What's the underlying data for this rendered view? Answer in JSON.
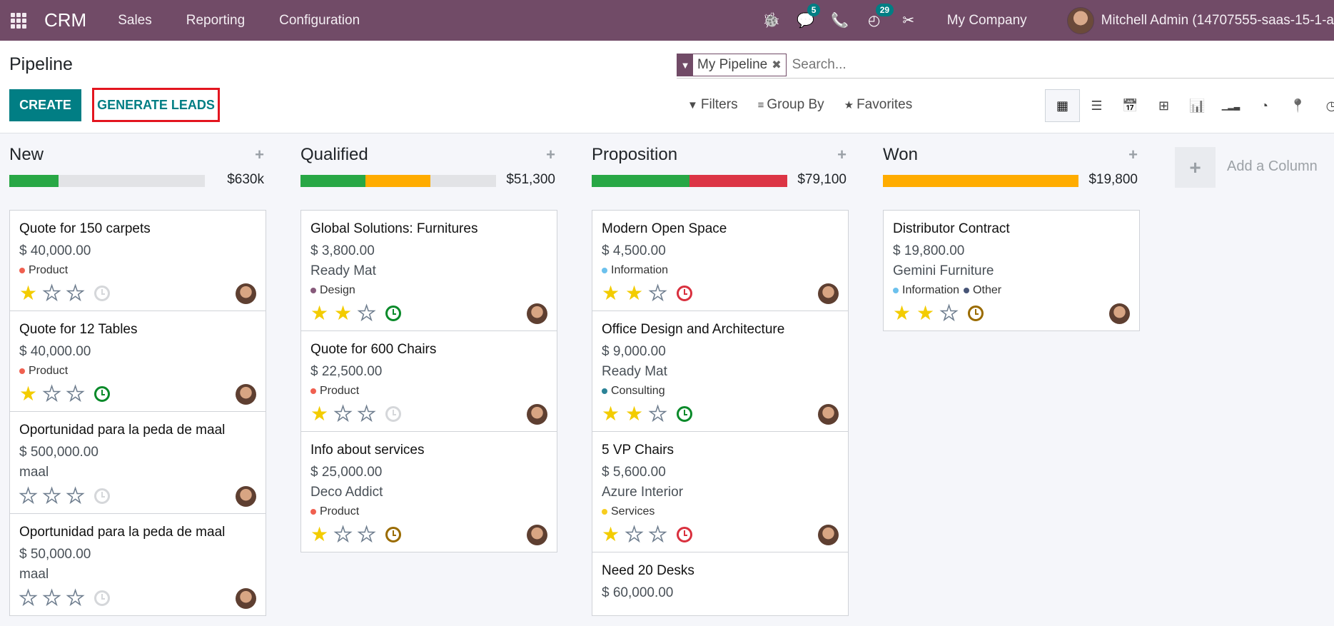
{
  "navbar": {
    "app_name": "CRM",
    "menus": [
      "Sales",
      "Reporting",
      "Configuration"
    ],
    "icons": [
      {
        "name": "bug-icon",
        "glyph": "🐞",
        "badge": null
      },
      {
        "name": "chat-icon",
        "glyph": "💬",
        "badge": "5"
      },
      {
        "name": "phone-icon",
        "glyph": "📞",
        "badge": null
      },
      {
        "name": "activity-clock-icon",
        "glyph": "◴",
        "badge": "29"
      },
      {
        "name": "tools-icon",
        "glyph": "✂",
        "badge": null
      }
    ],
    "company": "My Company",
    "user": "Mitchell Admin (14707555-saas-15-1-a"
  },
  "control_panel": {
    "title": "Pipeline",
    "create_label": "CREATE",
    "generate_label": "GENERATE LEADS",
    "facet_label": "My Pipeline",
    "search_placeholder": "Search...",
    "filters_label": "Filters",
    "groupby_label": "Group By",
    "favorites_label": "Favorites",
    "views": [
      {
        "name": "kanban-view-icon",
        "glyph": "▦",
        "active": true
      },
      {
        "name": "list-view-icon",
        "glyph": "☰",
        "active": false
      },
      {
        "name": "calendar-view-icon",
        "glyph": "📅",
        "active": false
      },
      {
        "name": "pivot-view-icon",
        "glyph": "⊞",
        "active": false
      },
      {
        "name": "graph-view-icon",
        "glyph": "📊",
        "active": false
      },
      {
        "name": "cohort-view-icon",
        "glyph": "▁▂▃",
        "active": false
      },
      {
        "name": "dashboard-view-icon",
        "glyph": "◔",
        "active": false
      },
      {
        "name": "map-view-icon",
        "glyph": "📍",
        "active": false
      },
      {
        "name": "activity-view-icon",
        "glyph": "◷",
        "active": false
      }
    ]
  },
  "colors": {
    "brand": "#714b67",
    "primary": "#017e84",
    "highlight_border": "#e3151f",
    "green": "#28a745",
    "orange": "#ffac00",
    "red": "#dc3545",
    "grey": "#e2e3e6"
  },
  "columns": [
    {
      "title": "New",
      "total": "$630k",
      "progress": [
        {
          "color": "#28a745",
          "fraction": 0.25
        }
      ],
      "cards": [
        {
          "title": "Quote for 150 carpets",
          "amount": "$ 40,000.00",
          "partner": null,
          "tags": [
            {
              "label": "Product",
              "color": "#f06050"
            }
          ],
          "stars": 1,
          "activity": "none"
        },
        {
          "title": "Quote for 12 Tables",
          "amount": "$ 40,000.00",
          "partner": null,
          "tags": [
            {
              "label": "Product",
              "color": "#f06050"
            }
          ],
          "stars": 1,
          "activity": "planned"
        },
        {
          "title": "Oportunidad para la peda de maal",
          "amount": "$ 500,000.00",
          "partner": "maal",
          "tags": [],
          "stars": 0,
          "activity": "none"
        },
        {
          "title": "Oportunidad para la peda de maal",
          "amount": "$ 50,000.00",
          "partner": "maal",
          "tags": [],
          "stars": 0,
          "activity": "none"
        }
      ]
    },
    {
      "title": "Qualified",
      "total": "$51,300",
      "progress": [
        {
          "color": "#28a745",
          "fraction": 0.333
        },
        {
          "color": "#ffac00",
          "fraction": 0.333
        }
      ],
      "cards": [
        {
          "title": "Global Solutions: Furnitures",
          "amount": "$ 3,800.00",
          "partner": "Ready Mat",
          "tags": [
            {
              "label": "Design",
              "color": "#875a7b"
            }
          ],
          "stars": 2,
          "activity": "planned"
        },
        {
          "title": "Quote for 600 Chairs",
          "amount": "$ 22,500.00",
          "partner": null,
          "tags": [
            {
              "label": "Product",
              "color": "#f06050"
            }
          ],
          "stars": 1,
          "activity": "none"
        },
        {
          "title": "Info about services",
          "amount": "$ 25,000.00",
          "partner": "Deco Addict",
          "tags": [
            {
              "label": "Product",
              "color": "#f06050"
            }
          ],
          "stars": 1,
          "activity": "today"
        }
      ]
    },
    {
      "title": "Proposition",
      "total": "$79,100",
      "progress": [
        {
          "color": "#28a745",
          "fraction": 0.5
        },
        {
          "color": "#dc3545",
          "fraction": 0.5
        }
      ],
      "cards": [
        {
          "title": "Modern Open Space",
          "amount": "$ 4,500.00",
          "partner": null,
          "tags": [
            {
              "label": "Information",
              "color": "#6cc1ed"
            }
          ],
          "stars": 2,
          "activity": "overdue"
        },
        {
          "title": "Office Design and Architecture",
          "amount": "$ 9,000.00",
          "partner": "Ready Mat",
          "tags": [
            {
              "label": "Consulting",
              "color": "#2c8397"
            }
          ],
          "stars": 2,
          "activity": "planned"
        },
        {
          "title": "5 VP Chairs",
          "amount": "$ 5,600.00",
          "partner": "Azure Interior",
          "tags": [
            {
              "label": "Services",
              "color": "#f7cd1f"
            }
          ],
          "stars": 1,
          "activity": "overdue"
        },
        {
          "title": "Need 20 Desks",
          "amount": "$ 60,000.00",
          "partner": null,
          "tags": [],
          "stars": 0,
          "activity": "none"
        }
      ]
    },
    {
      "title": "Won",
      "total": "$19,800",
      "progress": [
        {
          "color": "#ffac00",
          "fraction": 1.0
        }
      ],
      "cards": [
        {
          "title": "Distributor Contract",
          "amount": "$ 19,800.00",
          "partner": "Gemini Furniture",
          "tags": [
            {
              "label": "Information",
              "color": "#6cc1ed"
            },
            {
              "label": "Other",
              "color": "#475577"
            }
          ],
          "stars": 2,
          "activity": "today"
        }
      ]
    }
  ],
  "add_column_label": "Add a Column"
}
